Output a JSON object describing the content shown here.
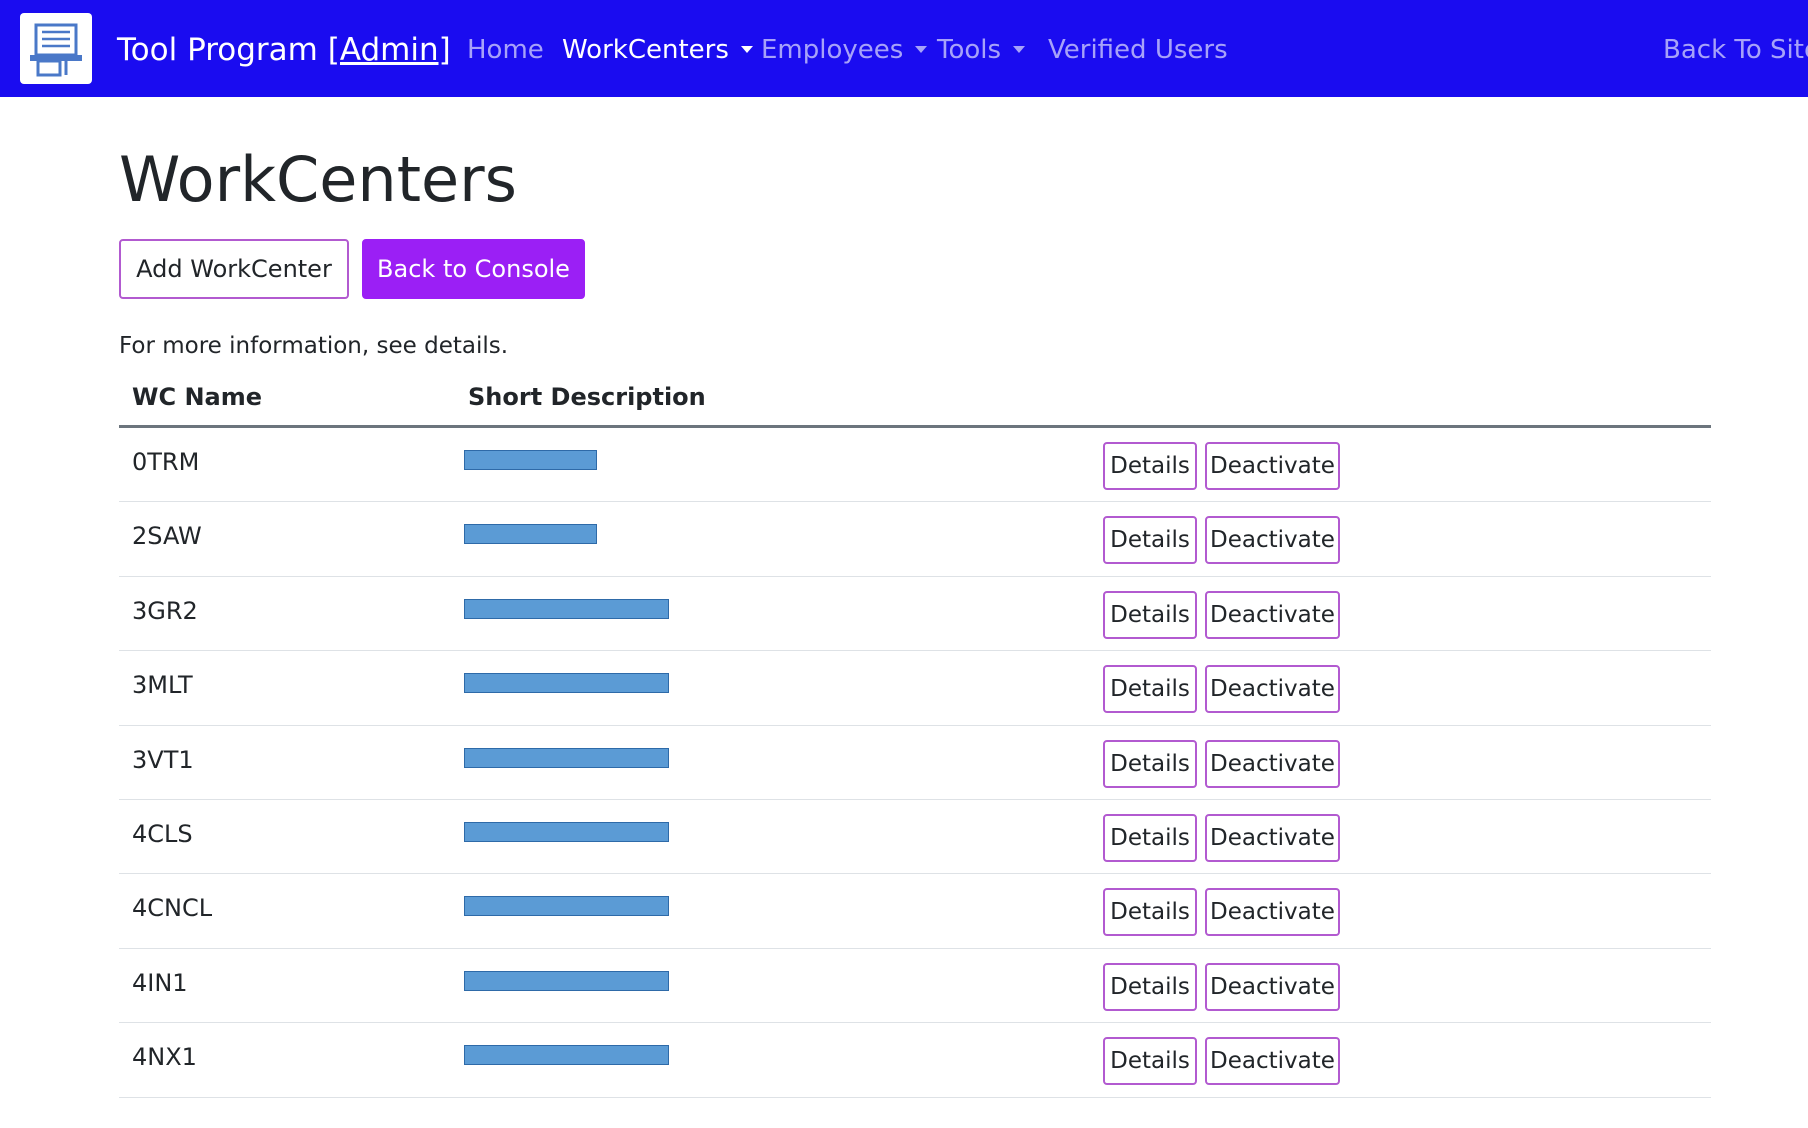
{
  "navbar": {
    "brand_title": "Tool Program",
    "brand_role": "[Admin]",
    "items": [
      {
        "label": "Home",
        "dropdown": false
      },
      {
        "label": "WorkCenters",
        "dropdown": true
      },
      {
        "label": "Employees",
        "dropdown": true
      },
      {
        "label": "Tools",
        "dropdown": true
      },
      {
        "label": "Verified Users",
        "dropdown": false
      }
    ],
    "back_to_site": "Back To Site",
    "colors": {
      "background": "#1a0cf0"
    }
  },
  "page": {
    "title": "WorkCenters",
    "add_button": "Add WorkCenter",
    "console_button": "Back to Console",
    "info_text": "For more information, see details.",
    "colors": {
      "primary_button": "#9b1ff5",
      "outline_border": "#b25ad0",
      "redaction": "#5b9bd5"
    }
  },
  "table": {
    "headers": [
      "WC Name",
      "Short Description"
    ],
    "row_action_details": "Details",
    "row_action_deactivate": "Deactivate",
    "rows": [
      {
        "name": "0TRM",
        "description_redacted": true
      },
      {
        "name": "2SAW",
        "description_redacted": true
      },
      {
        "name": "3GR2",
        "description_redacted": true
      },
      {
        "name": "3MLT",
        "description_redacted": true
      },
      {
        "name": "3VT1",
        "description_redacted": true
      },
      {
        "name": "4CLS",
        "description_redacted": true
      },
      {
        "name": "4CNCL",
        "description_redacted": true
      },
      {
        "name": "4IN1",
        "description_redacted": true
      },
      {
        "name": "4NX1",
        "description_redacted": true
      }
    ]
  }
}
